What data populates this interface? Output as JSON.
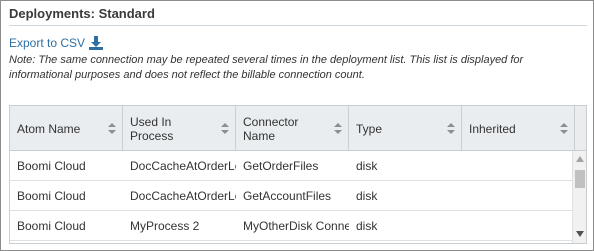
{
  "panel": {
    "title": "Deployments: Standard",
    "export_label": "Export to CSV",
    "export_icon": "download-icon",
    "note": "Note: The same connection may be repeated several times in the deployment list. This list is displayed for informational purposes and does not reflect the billable connection count."
  },
  "table": {
    "columns": [
      {
        "label": "Atom Name"
      },
      {
        "label": "Used In Process"
      },
      {
        "label": "Connector Name"
      },
      {
        "label": "Type"
      },
      {
        "label": "Inherited"
      }
    ],
    "rows": [
      {
        "atom": "Boomi Cloud",
        "process": "DocCacheAtOrderLevel",
        "connector": "GetOrderFiles",
        "type": "disk",
        "inherited": ""
      },
      {
        "atom": "Boomi Cloud",
        "process": "DocCacheAtOrderLevel",
        "connector": "GetAccountFiles",
        "type": "disk",
        "inherited": ""
      },
      {
        "atom": "Boomi Cloud",
        "process": "MyProcess 2",
        "connector": "MyOtherDisk Connection",
        "type": "disk",
        "inherited": ""
      }
    ]
  },
  "colors": {
    "link": "#2f6fa4",
    "header_bg": "#e9edf0"
  }
}
